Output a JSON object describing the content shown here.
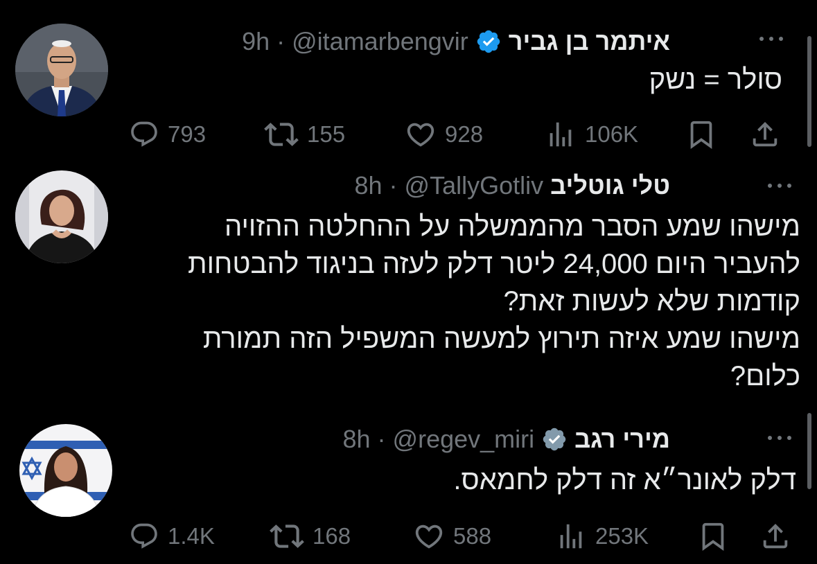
{
  "tweets": [
    {
      "name": "איתמר בן גביר",
      "handle": "@itamarbengvir",
      "sep": "·",
      "time": "9h",
      "text": [
        "סולר = נשק"
      ],
      "verified": true,
      "verified_color": "#1d9bf0",
      "actions": {
        "replies": "793",
        "retweets": "155",
        "likes": "928",
        "views": "106K"
      }
    },
    {
      "name": "טלי גוטליב",
      "handle": "@TallyGotliv",
      "sep": "·",
      "time": "8h",
      "verified": false,
      "text": [
        "מישהו שמע הסבר מהממשלה על ההחלטה ההזויה",
        "להעביר היום 24,000 ליטר דלק לעזה בניגוד להבטחות",
        "קודמות שלא לעשות זאת?",
        "מישהו שמע איזה תירוץ למעשה המשפיל הזה תמורת",
        "כלום?"
      ]
    },
    {
      "name": "מירי רגב",
      "handle": "@regev_miri",
      "sep": "·",
      "time": "8h",
      "verified": true,
      "verified_color": "#829aab",
      "text": [
        "דלק לאונר״א זה דלק לחמאס."
      ],
      "actions": {
        "replies": "1.4K",
        "retweets": "168",
        "likes": "588",
        "views": "253K"
      }
    }
  ],
  "icons": [
    "reply-icon",
    "retweet-icon",
    "like-icon",
    "views-icon",
    "bookmark-icon",
    "share-icon",
    "verified-badge-icon",
    "more-options-icon"
  ],
  "colors": {
    "background": "#000000",
    "text": "#e7e9ea",
    "secondary": "#71767b"
  }
}
